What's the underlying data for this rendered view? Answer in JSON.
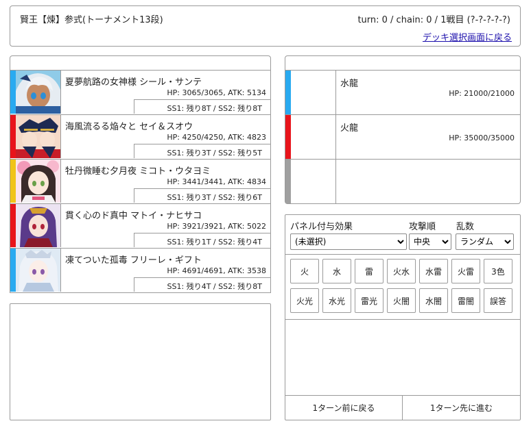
{
  "header": {
    "title": "賢王【煉】参式(トーナメント13段)",
    "status": "turn: 0 / chain: 0 / 1戦目 (?-?-?-?-?)",
    "back_link": "デッキ選択画面に戻る"
  },
  "party": [
    {
      "name": "夏夢航路の女神様 シール・サンテ",
      "stats": "HP: 3065/3065, ATK: 5134",
      "ss": "SS1: 残り8T / SS2: 残り8T",
      "color": "#29aaf0",
      "portrait": "silver-hair-character"
    },
    {
      "name": "海風流るる焔々と セイ＆スオウ",
      "stats": "HP: 4250/4250, ATK: 4823",
      "ss": "SS1: 残り3T / SS2: 残り5T",
      "color": "#e8141b",
      "portrait": "navy-captain-character"
    },
    {
      "name": "牡丹微睡む夕月夜 ミコト・ウタヨミ",
      "stats": "HP: 3441/3441, ATK: 4834",
      "ss": "SS1: 残り3T / SS2: 残り6T",
      "color": "#f0c419",
      "portrait": "kimono-character"
    },
    {
      "name": "貫く心のド真中 マトイ・ナヒサコ",
      "stats": "HP: 3921/3921, ATK: 5022",
      "ss": "SS1: 残り1T / SS2: 残り4T",
      "color": "#e8141b",
      "portrait": "purple-hair-character"
    },
    {
      "name": "凍てついた孤毒 フリーレ・ギフト",
      "stats": "HP: 4691/4691, ATK: 3538",
      "ss": "SS1: 残り4T / SS2: 残り8T",
      "color": "#29aaf0",
      "portrait": "white-hair-character"
    }
  ],
  "enemies": [
    {
      "name": "水龍",
      "hp": "HP: 21000/21000",
      "color": "#29aaf0"
    },
    {
      "name": "火龍",
      "hp": "HP: 35000/35000",
      "color": "#e8141b"
    },
    {
      "name": "",
      "hp": "",
      "color": "#a0a0a0"
    }
  ],
  "controls": {
    "panel_label": "パネル付与効果",
    "panel_value": "(未選択)",
    "order_label": "攻撃順",
    "order_value": "中央",
    "random_label": "乱数",
    "random_value": "ランダム"
  },
  "panel_buttons": [
    "火",
    "水",
    "雷",
    "火水",
    "水雷",
    "火雷",
    "3色",
    "火光",
    "水光",
    "雷光",
    "火闇",
    "水闇",
    "雷闇",
    "誤答"
  ],
  "nav": {
    "prev": "1ターン前に戻る",
    "next": "1ターン先に進む"
  }
}
